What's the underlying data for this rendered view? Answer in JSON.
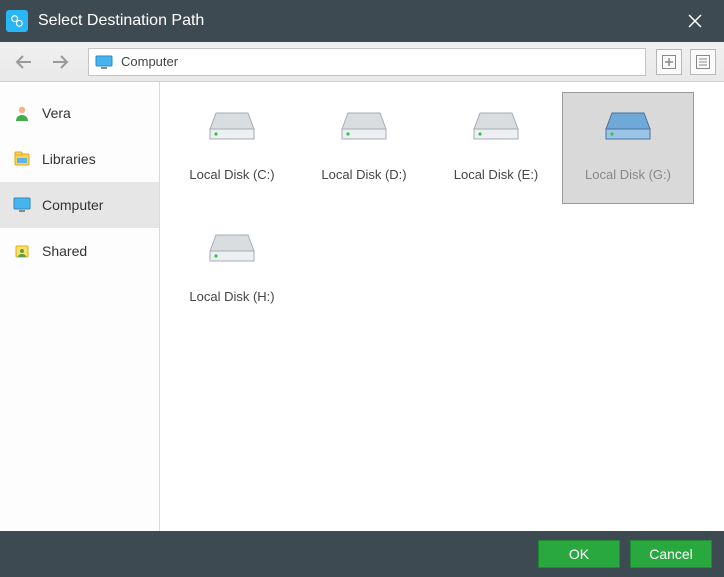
{
  "titlebar": {
    "title": "Select Destination Path"
  },
  "toolbar": {
    "path": "Computer"
  },
  "sidebar": {
    "items": [
      {
        "label": "Vera"
      },
      {
        "label": "Libraries"
      },
      {
        "label": "Computer"
      },
      {
        "label": "Shared"
      }
    ],
    "selected_index": 2
  },
  "drives": [
    {
      "label": "Local Disk (C:)",
      "selected": false
    },
    {
      "label": "Local Disk (D:)",
      "selected": false
    },
    {
      "label": "Local Disk (E:)",
      "selected": false
    },
    {
      "label": "Local Disk (G:)",
      "selected": true
    },
    {
      "label": "Local Disk (H:)",
      "selected": false
    }
  ],
  "footer": {
    "ok_label": "OK",
    "cancel_label": "Cancel"
  }
}
